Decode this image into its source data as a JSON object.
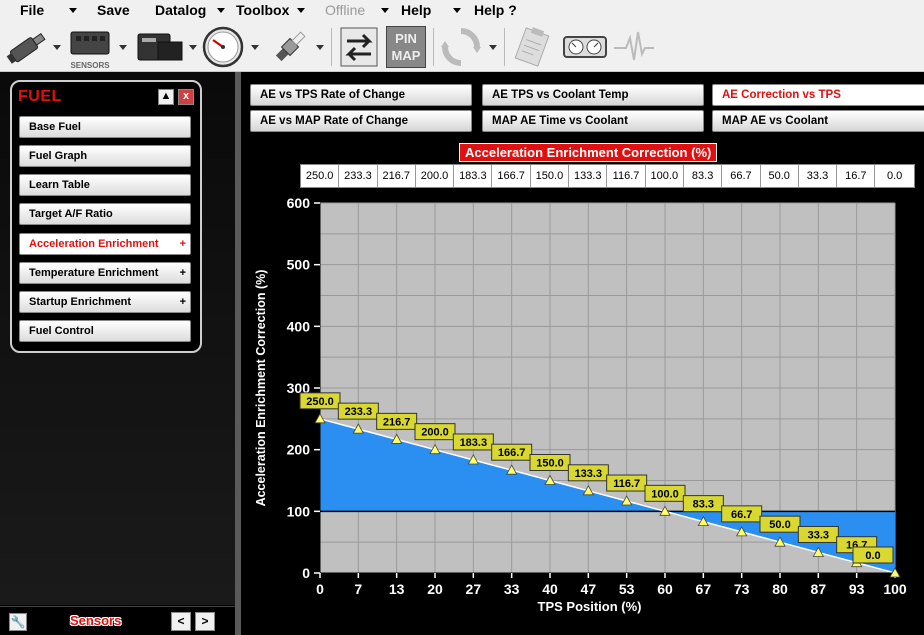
{
  "menu": {
    "file": "File",
    "save": "Save",
    "datalog": "Datalog",
    "toolbox": "Toolbox",
    "offline": "Offline",
    "help": "Help",
    "help_q": "Help ?"
  },
  "toolbar": {
    "icons": [
      "injector-icon",
      "sensors-icon",
      "efi-module-icon",
      "gauge-icon",
      "spark-plug-icon",
      "transfer-icon",
      "pin-map-icon",
      "refresh-icon",
      "clipboard-icon",
      "dual-gauge-icon",
      "waveform-icon"
    ],
    "sensors_label": "SENSORS",
    "pin_label_1": "PIN",
    "pin_label_2": "MAP"
  },
  "fuel_panel": {
    "title": "FUEL",
    "up_label": "▲",
    "close_label": "x",
    "items": [
      {
        "label": "Base Fuel",
        "plus": ""
      },
      {
        "label": "Fuel Graph",
        "plus": ""
      },
      {
        "label": "Learn Table",
        "plus": ""
      },
      {
        "label": "Target A/F Ratio",
        "plus": ""
      },
      {
        "label": "Acceleration Enrichment",
        "plus": "+"
      },
      {
        "label": "Temperature Enrichment",
        "plus": "+"
      },
      {
        "label": "Startup Enrichment",
        "plus": "+"
      },
      {
        "label": "Fuel Control",
        "plus": ""
      }
    ],
    "active_index": 4
  },
  "sensors_bar": {
    "label": "Sensors",
    "prev": "<",
    "next": ">"
  },
  "tabs": [
    {
      "label": "AE vs TPS Rate of Change"
    },
    {
      "label": "AE TPS vs Coolant Temp"
    },
    {
      "label": "AE Correction vs TPS"
    },
    {
      "label": "AE vs MAP Rate of Change"
    },
    {
      "label": "MAP AE Time vs Coolant"
    },
    {
      "label": "MAP AE vs Coolant"
    }
  ],
  "active_tab": 2,
  "colors": {
    "accent_red": "#e01010",
    "plot_bg": "#c0c0c0",
    "fill_blue": "#2a8ff0",
    "label_yellow": "#d8d830"
  },
  "chart_data": {
    "type": "line",
    "title": "Acceleration Enrichment Correction (%)",
    "xlabel": "TPS Position (%)",
    "ylabel": "Acceleration Enrichment Correction (%)",
    "x": [
      0,
      7,
      13,
      20,
      27,
      33,
      40,
      47,
      53,
      60,
      67,
      73,
      80,
      87,
      93,
      100
    ],
    "x_tick_labels": [
      "0",
      "7",
      "13",
      "20",
      "27",
      "33",
      "40",
      "47",
      "53",
      "60",
      "67",
      "73",
      "80",
      "87",
      "93",
      "100"
    ],
    "values": [
      250.0,
      233.3,
      216.7,
      200.0,
      183.3,
      166.7,
      150.0,
      133.3,
      116.7,
      100.0,
      83.3,
      66.7,
      50.0,
      33.3,
      16.7,
      0.0
    ],
    "value_labels": [
      "250.0",
      "233.3",
      "216.7",
      "200.0",
      "183.3",
      "166.7",
      "150.0",
      "133.3",
      "116.7",
      "100.0",
      "83.3",
      "66.7",
      "50.0",
      "33.3",
      "16.7",
      "0.0"
    ],
    "y_tick_labels": [
      "0",
      "100",
      "200",
      "300",
      "400",
      "500",
      "600"
    ],
    "ylim": [
      0,
      600
    ],
    "xlim": [
      0,
      100
    ],
    "reference_line": 100,
    "grid": true
  }
}
